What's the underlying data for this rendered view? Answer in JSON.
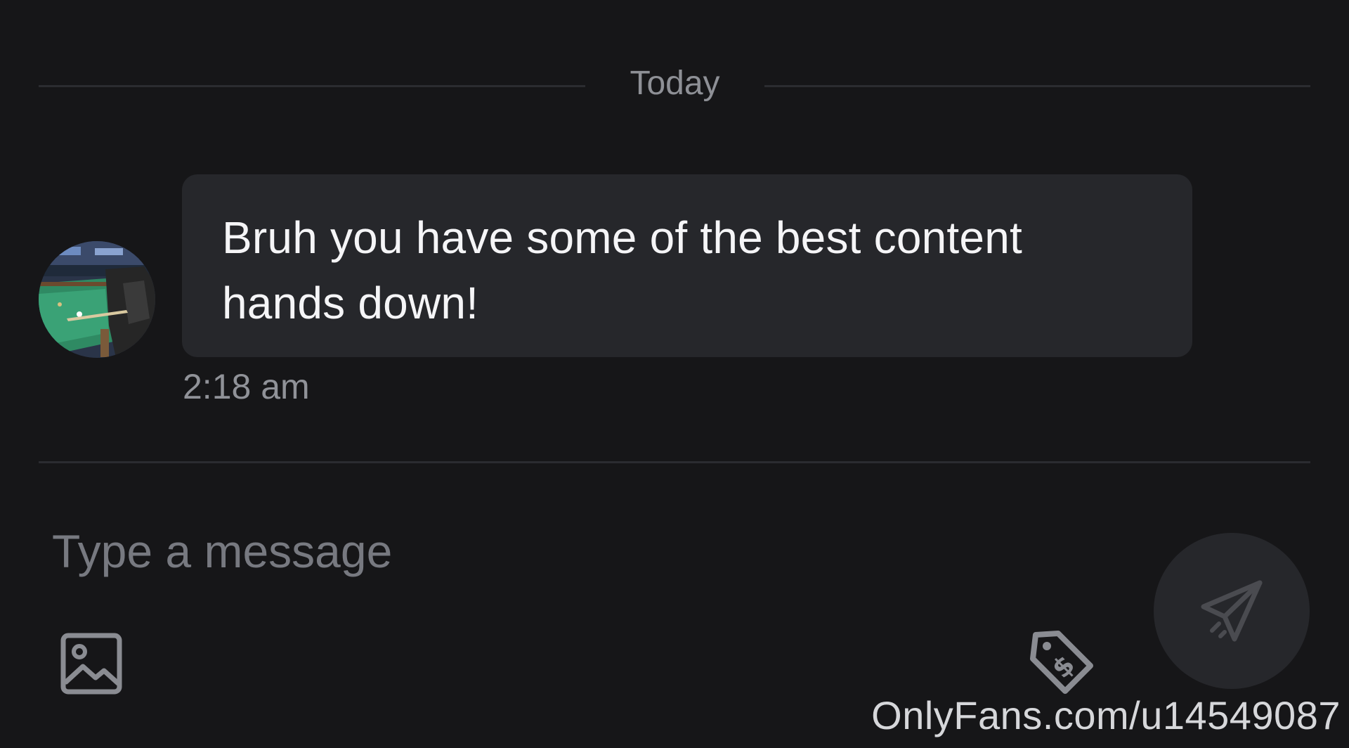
{
  "conversation": {
    "date_divider": "Today",
    "messages": [
      {
        "text": "Bruh you have some of the best content hands down!",
        "time": "2:18 am"
      }
    ]
  },
  "composer": {
    "placeholder": "Type a message",
    "icons": {
      "image": "image-icon",
      "price": "price-tag-icon",
      "send": "send-icon"
    }
  },
  "watermark": "OnlyFans.com/u14549087",
  "colors": {
    "background": "#161618",
    "bubble": "#26272b",
    "divider": "#2b2c30",
    "message_text": "#f5f5f7",
    "muted_text": "#8e9096",
    "icon": "#8a8c92"
  }
}
